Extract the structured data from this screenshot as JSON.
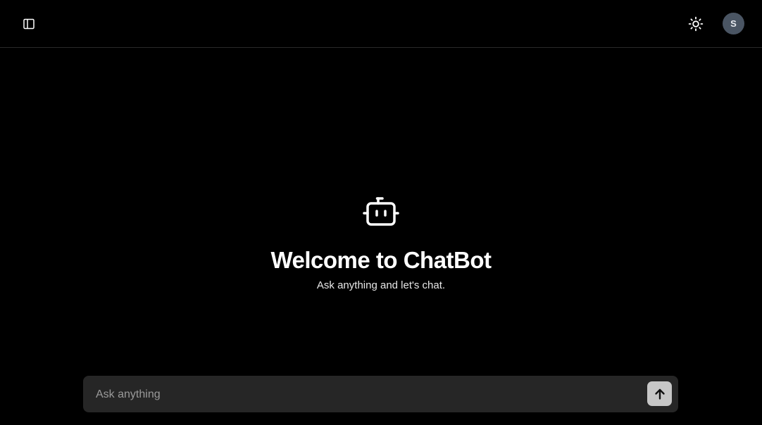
{
  "header": {
    "sidebar_toggle_icon": "sidebar-panel-icon",
    "theme_toggle_icon": "sun-icon",
    "avatar_initial": "S"
  },
  "hero": {
    "icon": "bot-icon",
    "title": "Welcome to ChatBot",
    "subtitle": "Ask anything and let's chat."
  },
  "composer": {
    "placeholder": "Ask anything",
    "value": "",
    "send_icon": "arrow-up-icon"
  },
  "colors": {
    "background": "#000000",
    "composer_background": "#262626",
    "send_button": "#c7c7c7",
    "avatar": "#4a5563",
    "divider": "#2a2a2a"
  }
}
